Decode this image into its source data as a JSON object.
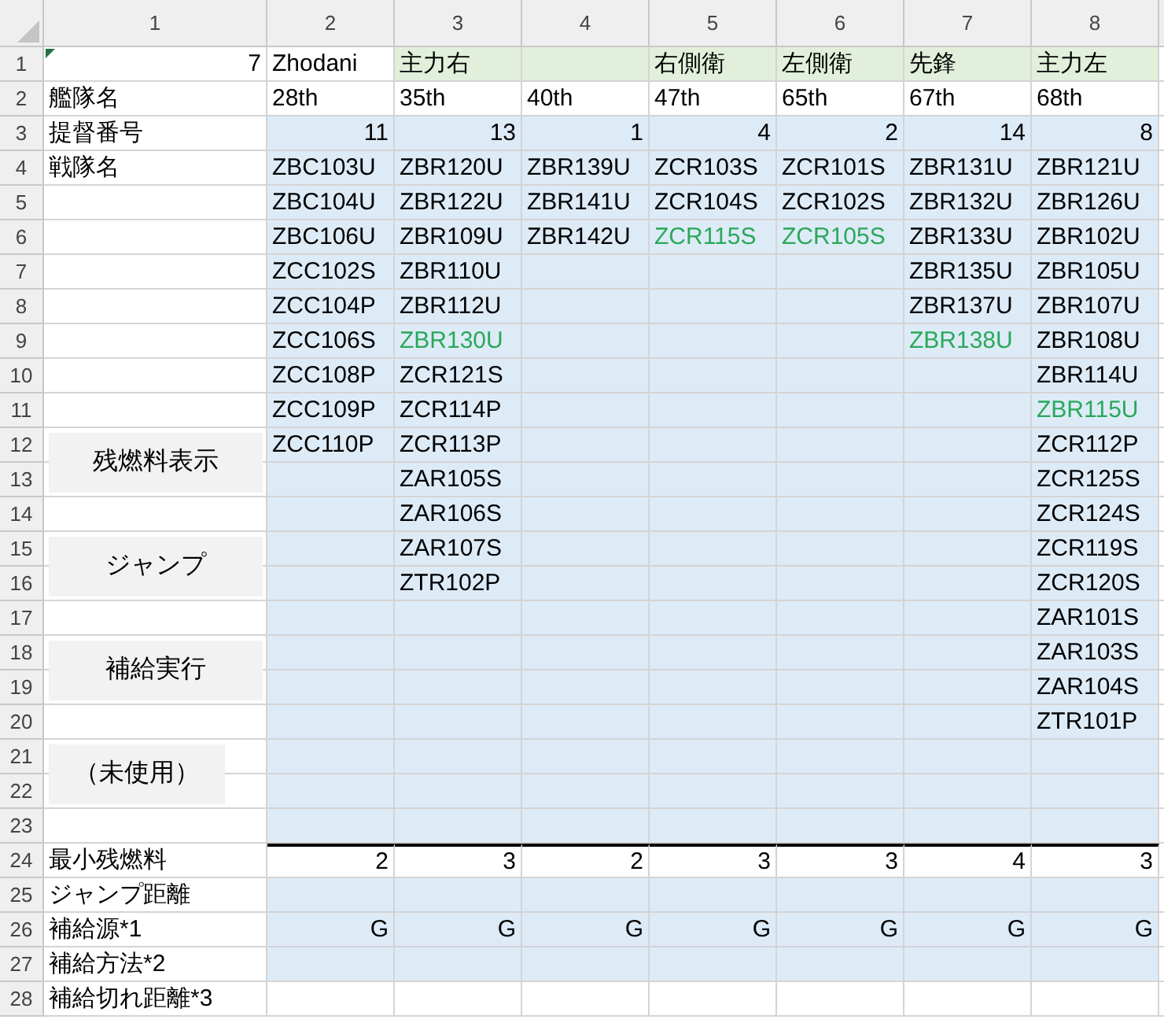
{
  "column_headers": [
    "1",
    "2",
    "3",
    "4",
    "5",
    "6",
    "7",
    "8"
  ],
  "row_headers": [
    "1",
    "2",
    "3",
    "4",
    "5",
    "6",
    "7",
    "8",
    "9",
    "10",
    "11",
    "12",
    "13",
    "14",
    "15",
    "16",
    "17",
    "18",
    "19",
    "20",
    "21",
    "22",
    "23",
    "24",
    "25",
    "26",
    "27",
    "28"
  ],
  "side": {
    "top_value": "7",
    "header_labels": [
      "艦隊名",
      "提督番号",
      "戦隊名"
    ],
    "footer_labels": [
      "最小残燃料",
      "ジャンプ距離",
      "補給源*1",
      "補給方法*2",
      "補給切れ距離*3"
    ]
  },
  "buttons": [
    "残燃料表示",
    "ジャンプ",
    "補給実行",
    "（未使用）"
  ],
  "fleets": [
    {
      "role": "Zhodani",
      "role_shaded": false,
      "name": "28th",
      "admiral": "11",
      "min_fuel": "2",
      "supply_source": "G",
      "ships": [
        {
          "id": "ZBC103U",
          "highlighted": false
        },
        {
          "id": "ZBC104U",
          "highlighted": false
        },
        {
          "id": "ZBC106U",
          "highlighted": false
        },
        {
          "id": "ZCC102S",
          "highlighted": false
        },
        {
          "id": "ZCC104P",
          "highlighted": false
        },
        {
          "id": "ZCC106S",
          "highlighted": false
        },
        {
          "id": "ZCC108P",
          "highlighted": false
        },
        {
          "id": "ZCC109P",
          "highlighted": false
        },
        {
          "id": "ZCC110P",
          "highlighted": false
        }
      ]
    },
    {
      "role": "主力右",
      "role_shaded": true,
      "name": "35th",
      "admiral": "13",
      "min_fuel": "3",
      "supply_source": "G",
      "ships": [
        {
          "id": "ZBR120U",
          "highlighted": false
        },
        {
          "id": "ZBR122U",
          "highlighted": false
        },
        {
          "id": "ZBR109U",
          "highlighted": false
        },
        {
          "id": "ZBR110U",
          "highlighted": false
        },
        {
          "id": "ZBR112U",
          "highlighted": false
        },
        {
          "id": "ZBR130U",
          "highlighted": true
        },
        {
          "id": "ZCR121S",
          "highlighted": false
        },
        {
          "id": "ZCR114P",
          "highlighted": false
        },
        {
          "id": "ZCR113P",
          "highlighted": false
        },
        {
          "id": "ZAR105S",
          "highlighted": false
        },
        {
          "id": "ZAR106S",
          "highlighted": false
        },
        {
          "id": "ZAR107S",
          "highlighted": false
        },
        {
          "id": "ZTR102P",
          "highlighted": false
        }
      ]
    },
    {
      "role_shaded": true,
      "name": "40th",
      "admiral": "1",
      "min_fuel": "2",
      "supply_source": "G",
      "ships": [
        {
          "id": "ZBR139U",
          "highlighted": false
        },
        {
          "id": "ZBR141U",
          "highlighted": false
        },
        {
          "id": "ZBR142U",
          "highlighted": false
        }
      ]
    },
    {
      "role": "右側衛",
      "role_shaded": true,
      "name": "47th",
      "admiral": "4",
      "min_fuel": "3",
      "supply_source": "G",
      "ships": [
        {
          "id": "ZCR103S",
          "highlighted": false
        },
        {
          "id": "ZCR104S",
          "highlighted": false
        },
        {
          "id": "ZCR115S",
          "highlighted": true
        }
      ]
    },
    {
      "role": "左側衛",
      "role_shaded": true,
      "name": "65th",
      "admiral": "2",
      "min_fuel": "3",
      "supply_source": "G",
      "ships": [
        {
          "id": "ZCR101S",
          "highlighted": false
        },
        {
          "id": "ZCR102S",
          "highlighted": false
        },
        {
          "id": "ZCR105S",
          "highlighted": true
        }
      ]
    },
    {
      "role": "先鋒",
      "role_shaded": true,
      "name": "67th",
      "admiral": "14",
      "min_fuel": "4",
      "supply_source": "G",
      "ships": [
        {
          "id": "ZBR131U",
          "highlighted": false
        },
        {
          "id": "ZBR132U",
          "highlighted": false
        },
        {
          "id": "ZBR133U",
          "highlighted": false
        },
        {
          "id": "ZBR135U",
          "highlighted": false
        },
        {
          "id": "ZBR137U",
          "highlighted": false
        },
        {
          "id": "ZBR138U",
          "highlighted": true
        }
      ]
    },
    {
      "role": "主力左",
      "role_shaded": true,
      "name": "68th",
      "admiral": "8",
      "min_fuel": "3",
      "supply_source": "G",
      "ships": [
        {
          "id": "ZBR121U",
          "highlighted": false
        },
        {
          "id": "ZBR126U",
          "highlighted": false
        },
        {
          "id": "ZBR102U",
          "highlighted": false
        },
        {
          "id": "ZBR105U",
          "highlighted": false
        },
        {
          "id": "ZBR107U",
          "highlighted": false
        },
        {
          "id": "ZBR108U",
          "highlighted": false
        },
        {
          "id": "ZBR114U",
          "highlighted": false
        },
        {
          "id": "ZBR115U",
          "highlighted": true
        },
        {
          "id": "ZCR112P",
          "highlighted": false
        },
        {
          "id": "ZCR125S",
          "highlighted": false
        },
        {
          "id": "ZCR124S",
          "highlighted": false
        },
        {
          "id": "ZCR119S",
          "highlighted": false
        },
        {
          "id": "ZCR120S",
          "highlighted": false
        },
        {
          "id": "ZAR101S",
          "highlighted": false
        },
        {
          "id": "ZAR103S",
          "highlighted": false
        },
        {
          "id": "ZAR104S",
          "highlighted": false
        },
        {
          "id": "ZTR101P",
          "highlighted": false
        }
      ]
    }
  ]
}
